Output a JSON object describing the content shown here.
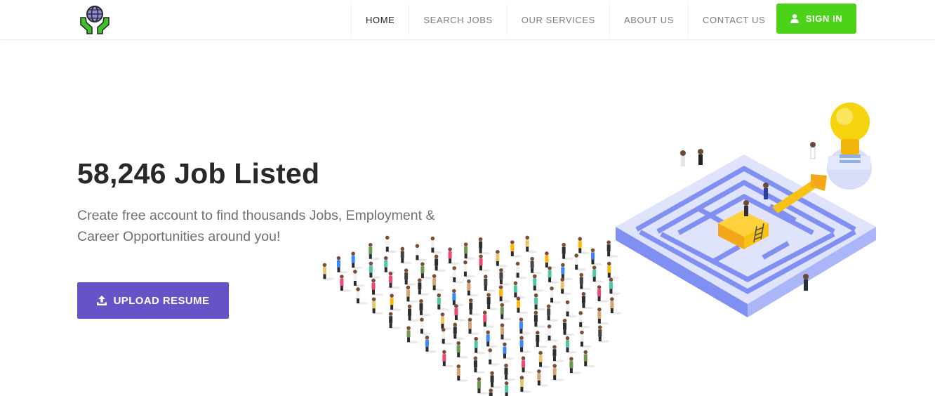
{
  "header": {
    "logo_icon": "globe-in-hands-icon",
    "nav": [
      {
        "label": "HOME",
        "active": true
      },
      {
        "label": "SEARCH JOBS",
        "active": false
      },
      {
        "label": "OUR SERVICES",
        "active": false
      },
      {
        "label": "ABOUT US",
        "active": false
      },
      {
        "label": "CONTACT US",
        "active": false
      }
    ],
    "signin": {
      "label": "SIGN IN",
      "icon": "user-icon",
      "color": "#4cd218"
    }
  },
  "hero": {
    "title": "58,246 Job Listed",
    "subtitle": "Create free account to find thousands Jobs, Employment & Career Opportunities around you!",
    "upload_button": {
      "label": "UPLOAD RESUME",
      "icon": "upload-icon",
      "color": "#6752c7"
    }
  },
  "illustration": {
    "icon": "maze-crowd-lightbulb-illustration",
    "colors": {
      "maze": "#7f8ff2",
      "maze_light": "#d7ddfb",
      "key": "#f7c211",
      "bulb": "#f5d30f"
    }
  }
}
